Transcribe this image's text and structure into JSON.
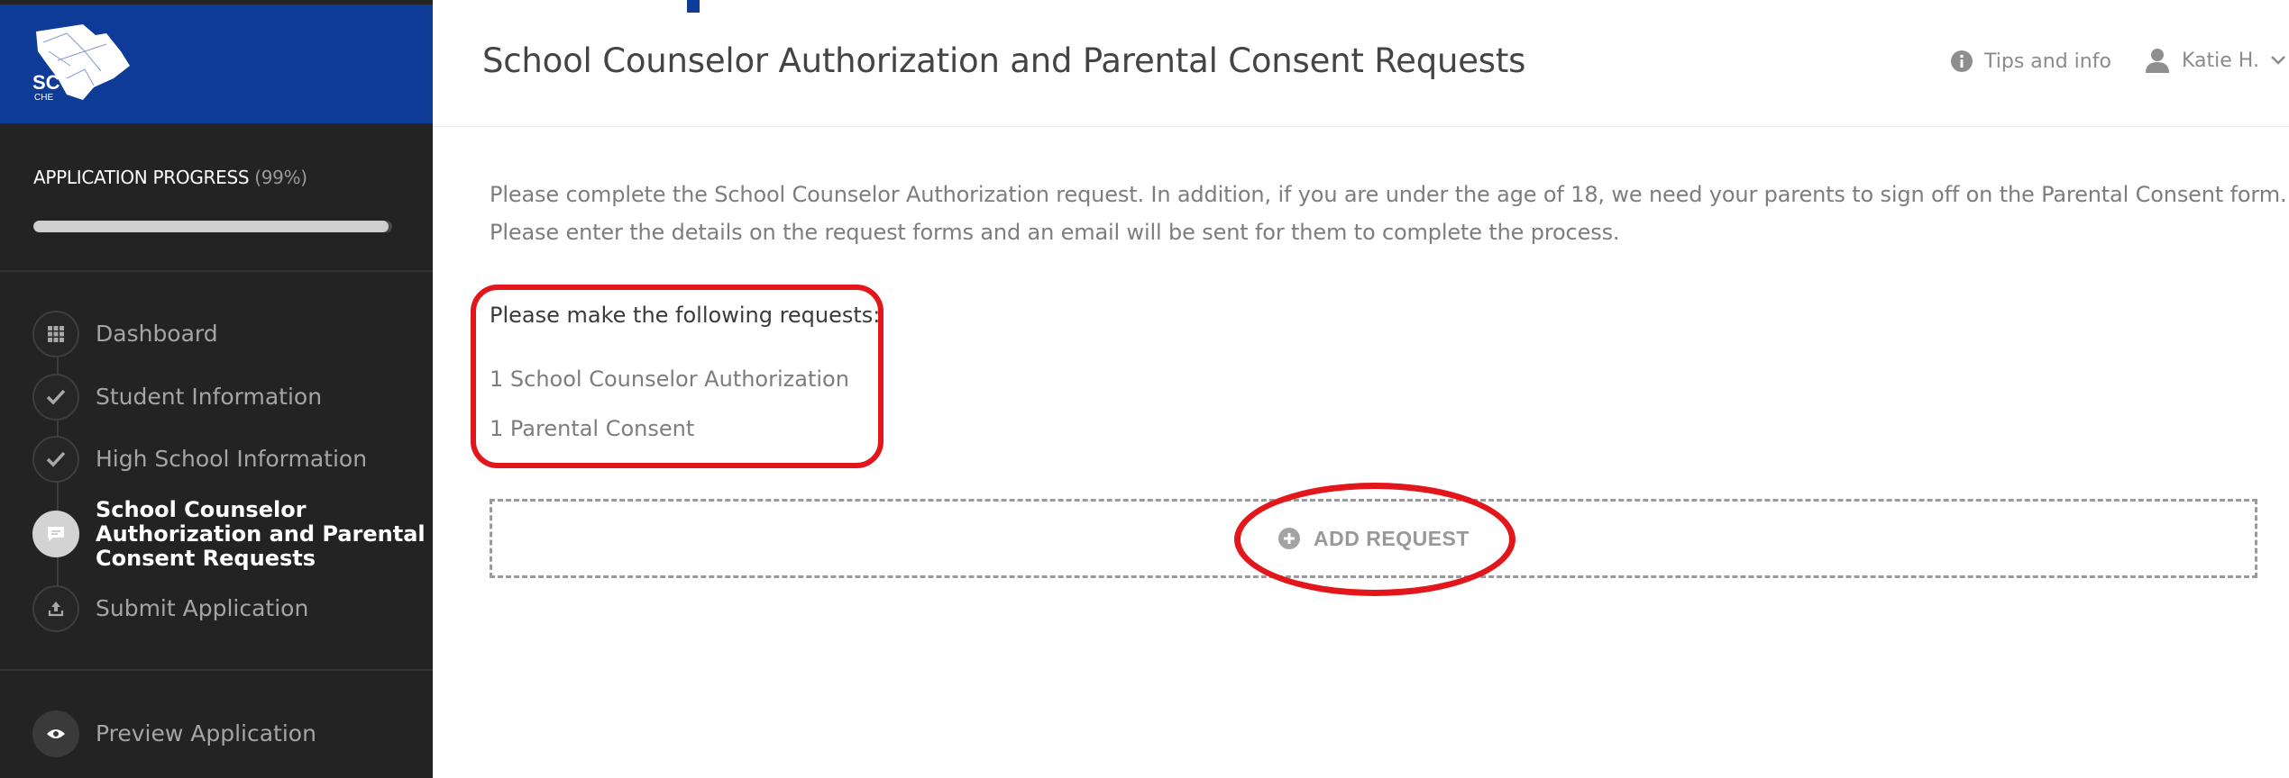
{
  "logo": {
    "text": "SC",
    "subtext": "CHE"
  },
  "sidebar": {
    "progress": {
      "label": "APPLICATION PROGRESS",
      "percent_text": "(99%)",
      "fraction": 0.99
    },
    "nav": [
      {
        "label": "Dashboard",
        "icon": "grid-icon",
        "state": "default"
      },
      {
        "label": "Student Information",
        "icon": "check-icon",
        "state": "done"
      },
      {
        "label": "High School Information",
        "icon": "check-icon",
        "state": "done"
      },
      {
        "label_lines": [
          "School Counselor",
          "Authorization and Parental",
          "Consent Requests"
        ],
        "icon": "comment-icon",
        "state": "active"
      },
      {
        "label": "Submit Application",
        "icon": "upload-icon",
        "state": "default"
      }
    ],
    "preview": {
      "label": "Preview Application",
      "icon": "eye-icon"
    }
  },
  "header": {
    "title": "School Counselor Authorization and Parental Consent Requests",
    "tips_label": "Tips and info",
    "user_name": "Katie H."
  },
  "main": {
    "intro_lines": [
      "Please complete the School Counselor Authorization request. In addition, if you are under the age of 18, we need your parents to sign off on the Parental Consent form.",
      "Please enter the details on the request forms and an email will be sent for them to complete the process."
    ],
    "requests_heading": "Please make the following requests:",
    "requests": [
      "1 School Counselor Authorization",
      "1 Parental Consent"
    ],
    "add_request_label": "ADD REQUEST"
  },
  "colors": {
    "brand_blue": "#0d3b97",
    "sidebar_bg": "#232323",
    "highlight_red": "#e3161b"
  }
}
